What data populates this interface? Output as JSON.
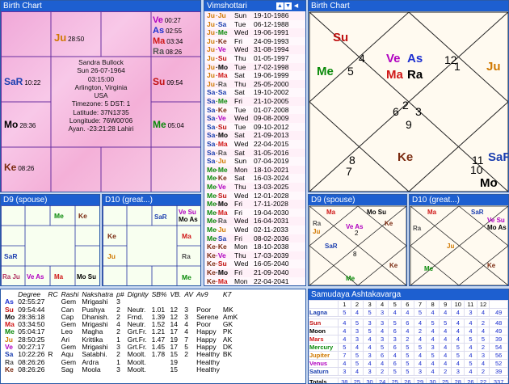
{
  "birth_chart_title": "Birth Chart",
  "vimshottari_title": "Vimshottari",
  "birth_chart2_title": "Birth Chart",
  "d9_title": "D9 (spouse)",
  "d10_title": "D10 (great...)",
  "d9b_title": "D9 (spouse)",
  "d10b_title": "D10 (great...)",
  "samudaya_title": "Samudaya Ashtakavarga",
  "info": {
    "name": "Sandra Bullock",
    "date": "Sun 26-07-1964",
    "time": "03:15:00",
    "place": "Arlington, Virginia",
    "country": "USA",
    "tz": "Timezone: 5 DST: 1",
    "lat": "Latitude: 37N13'35",
    "lon": "Longitude: 76W00'06",
    "ayan": "Ayan. -23:21:28 Lahiri"
  },
  "south_chart": {
    "c1": [
      {
        "p": "Ju",
        "d": "28:50"
      }
    ],
    "c3": [
      {
        "p": "Ve",
        "d": "00:27"
      },
      {
        "p": "As",
        "d": "02:55"
      },
      {
        "p": "Ma",
        "d": "03:34"
      },
      {
        "p": "Ra",
        "d": "08:26"
      }
    ],
    "c12": [
      {
        "p": "SaR",
        "d": "10:22"
      }
    ],
    "c4": [
      {
        "p": "Su",
        "d": "09:54"
      }
    ],
    "c11": [
      {
        "p": "Mo",
        "d": "28:36"
      }
    ],
    "c5": [
      {
        "p": "Me",
        "d": "05:04"
      }
    ],
    "c10": [
      {
        "p": "Ke",
        "d": "08:26"
      }
    ]
  },
  "vimshottari": [
    {
      "a": "Ju",
      "b": "Ju",
      "day": "Sun",
      "date": "19-10-1986"
    },
    {
      "a": "Ju",
      "b": "Sa",
      "day": "Tue",
      "date": "06-12-1988"
    },
    {
      "a": "Ju",
      "b": "Me",
      "day": "Wed",
      "date": "19-06-1991"
    },
    {
      "a": "Ju",
      "b": "Ke",
      "day": "Fri",
      "date": "24-09-1993"
    },
    {
      "a": "Ju",
      "b": "Ve",
      "day": "Wed",
      "date": "31-08-1994"
    },
    {
      "a": "Ju",
      "b": "Su",
      "day": "Thu",
      "date": "01-05-1997"
    },
    {
      "a": "Ju",
      "b": "Mo",
      "day": "Tue",
      "date": "17-02-1998"
    },
    {
      "a": "Ju",
      "b": "Ma",
      "day": "Sat",
      "date": "19-06-1999"
    },
    {
      "a": "Ju",
      "b": "Ra",
      "day": "Thu",
      "date": "25-05-2000"
    },
    {
      "a": "Sa",
      "b": "Sa",
      "day": "Sat",
      "date": "19-10-2002"
    },
    {
      "a": "Sa",
      "b": "Me",
      "day": "Fri",
      "date": "21-10-2005"
    },
    {
      "a": "Sa",
      "b": "Ke",
      "day": "Tue",
      "date": "01-07-2008"
    },
    {
      "a": "Sa",
      "b": "Ve",
      "day": "Wed",
      "date": "09-08-2009"
    },
    {
      "a": "Sa",
      "b": "Su",
      "day": "Tue",
      "date": "09-10-2012"
    },
    {
      "a": "Sa",
      "b": "Mo",
      "day": "Sat",
      "date": "21-09-2013"
    },
    {
      "a": "Sa",
      "b": "Ma",
      "day": "Wed",
      "date": "22-04-2015"
    },
    {
      "a": "Sa",
      "b": "Ra",
      "day": "Sat",
      "date": "31-05-2016"
    },
    {
      "a": "Sa",
      "b": "Ju",
      "day": "Sun",
      "date": "07-04-2019"
    },
    {
      "a": "Me",
      "b": "Me",
      "day": "Mon",
      "date": "18-10-2021"
    },
    {
      "a": "Me",
      "b": "Ke",
      "day": "Sat",
      "date": "16-03-2024"
    },
    {
      "a": "Me",
      "b": "Ve",
      "day": "Thu",
      "date": "13-03-2025"
    },
    {
      "a": "Me",
      "b": "Su",
      "day": "Wed",
      "date": "12-01-2028"
    },
    {
      "a": "Me",
      "b": "Mo",
      "day": "Fri",
      "date": "17-11-2028"
    },
    {
      "a": "Me",
      "b": "Ma",
      "day": "Fri",
      "date": "19-04-2030"
    },
    {
      "a": "Me",
      "b": "Ra",
      "day": "Wed",
      "date": "16-04-2031"
    },
    {
      "a": "Me",
      "b": "Ju",
      "day": "Wed",
      "date": "02-11-2033"
    },
    {
      "a": "Me",
      "b": "Sa",
      "day": "Fri",
      "date": "08-02-2036"
    },
    {
      "a": "Ke",
      "b": "Ke",
      "day": "Mon",
      "date": "18-10-2038"
    },
    {
      "a": "Ke",
      "b": "Ve",
      "day": "Thu",
      "date": "17-03-2039"
    },
    {
      "a": "Ke",
      "b": "Su",
      "day": "Wed",
      "date": "16-05-2040"
    },
    {
      "a": "Ke",
      "b": "Mo",
      "day": "Fri",
      "date": "21-09-2040"
    },
    {
      "a": "Ke",
      "b": "Ma",
      "day": "Mon",
      "date": "22-04-2041"
    }
  ],
  "north_chart": {
    "h1": {
      "num": "2",
      "pl": [
        "Ve",
        "As",
        "Ma",
        "Ra"
      ]
    },
    "h2": {
      "num": "1",
      "pl": [
        "Ju"
      ]
    },
    "h3": {
      "num": "12",
      "pl": []
    },
    "h4": {
      "num": "11",
      "pl": [
        "SaR"
      ]
    },
    "h5": {
      "num": "10",
      "pl": [
        "Mo"
      ]
    },
    "h6": {
      "num": "9",
      "pl": []
    },
    "h7": {
      "num": "8",
      "pl": [
        "Ke"
      ]
    },
    "h8": {
      "num": "7",
      "pl": []
    },
    "h9": {
      "num": "6",
      "pl": []
    },
    "h10": {
      "num": "5",
      "pl": [
        "Me"
      ]
    },
    "h11": {
      "num": "4",
      "pl": [
        "Su"
      ]
    },
    "h12": {
      "num": "3",
      "pl": []
    }
  },
  "d9_south": {
    "r0": [
      "",
      "",
      "Me",
      "Ke"
    ],
    "r3": [
      "Ra Ju",
      "Ve As",
      "Ma",
      "Mo Su"
    ],
    "left2": "SaR"
  },
  "d10_south": {
    "c3": [
      "SaR",
      "Ve Su",
      "Mo As"
    ],
    "left1": "Ke",
    "right1": "Ma",
    "left2": "Ju",
    "right2": "Ra",
    "bot2": "Me"
  },
  "d9_north": {
    "labels": [
      "Ma",
      "Mo Su",
      "Ve As",
      "Ke",
      "Ra",
      "Ju",
      "SaR",
      "Me"
    ],
    "nums": [
      "2",
      "1",
      "12",
      "11",
      "10",
      "9",
      "8",
      "7",
      "6",
      "5",
      "4",
      "3"
    ]
  },
  "d10_north": {
    "labels": [
      "Ma",
      "SaR",
      "Ve Su",
      "Mo As",
      "Ju",
      "Ra",
      "Me",
      "Ke"
    ],
    "nums": [
      "6",
      "5",
      "4",
      "3",
      "2",
      "1",
      "12",
      "11",
      "10",
      "9",
      "8",
      "7"
    ]
  },
  "planet_table": {
    "headers": [
      "",
      "Degree",
      "RC",
      "Rashi",
      "Nakshatra",
      "p#",
      "Dignity",
      "SB%",
      "VB.",
      "AV",
      "Av9",
      "K7"
    ],
    "rows": [
      [
        "As",
        "02:55:27",
        "",
        "Gem",
        "Mrigashi",
        "3",
        "",
        "",
        "",
        "",
        "",
        ""
      ],
      [
        "Su",
        "09:54:44",
        "",
        "Can",
        "Pushya",
        "2",
        "Neutr.",
        "1.01",
        "12",
        "3",
        "Poor",
        "MK"
      ],
      [
        "Mo",
        "28:36:18",
        "",
        "Cap",
        "Dhanish.",
        "2",
        "Frnd.",
        "1.39",
        "12",
        "3",
        "Serene",
        "AmK"
      ],
      [
        "Ma",
        "03:34:50",
        "",
        "Gem",
        "Mrigashi",
        "4",
        "Neutr.",
        "1.52",
        "14",
        "4",
        "Poor",
        "GK"
      ],
      [
        "Me",
        "05:04:17",
        "",
        "Leo",
        "Magha",
        "2",
        "Grt.Fr.",
        "1.21",
        "17",
        "4",
        "Happy",
        "PK"
      ],
      [
        "Ju",
        "28:50:25",
        "",
        "Ari",
        "Krittika",
        "1",
        "Grt.Fr.",
        "1.47",
        "19",
        "7",
        "Happy",
        "AK"
      ],
      [
        "Ve",
        "00:27:17",
        "",
        "Gem",
        "Mrigashi",
        "3",
        "Grt.Fr.",
        "1.45",
        "17",
        "5",
        "Happy",
        "DK"
      ],
      [
        "Sa",
        "10:22:26",
        "R",
        "Aqu",
        "Satabhi.",
        "2",
        "Moolt.",
        "1.78",
        "15",
        "2",
        "Healthy",
        "BK"
      ],
      [
        "Ra",
        "08:26:26",
        "",
        "Gem",
        "Ardra",
        "1",
        "Moolt.",
        "",
        "19",
        "",
        "Healthy",
        ""
      ],
      [
        "Ke",
        "08:26:26",
        "",
        "Sag",
        "Moola",
        "3",
        "Moolt.",
        "",
        "15",
        "",
        "Healthy",
        ""
      ]
    ]
  },
  "samudaya": {
    "header": [
      "",
      "1",
      "2",
      "3",
      "4",
      "5",
      "6",
      "7",
      "8",
      "9",
      "10",
      "11",
      "12",
      ""
    ],
    "rows": [
      {
        "name": "Lagna",
        "vals": [
          "5",
          "4",
          "5",
          "3",
          "4",
          "4",
          "5",
          "4",
          "4",
          "4",
          "3",
          "4"
        ],
        "tot": "49"
      },
      {
        "name": "Sun",
        "vals": [
          "4",
          "5",
          "3",
          "3",
          "5",
          "6",
          "4",
          "5",
          "5",
          "4",
          "4",
          "2"
        ],
        "tot": "48"
      },
      {
        "name": "Moon",
        "vals": [
          "4",
          "3",
          "5",
          "4",
          "6",
          "4",
          "2",
          "4",
          "4",
          "4",
          "4",
          "4"
        ],
        "tot": "49"
      },
      {
        "name": "Mars",
        "vals": [
          "4",
          "3",
          "4",
          "3",
          "3",
          "2",
          "4",
          "4",
          "4",
          "4",
          "5",
          "5"
        ],
        "tot": "39"
      },
      {
        "name": "Mercury",
        "vals": [
          "5",
          "4",
          "4",
          "5",
          "6",
          "5",
          "5",
          "3",
          "4",
          "5",
          "4",
          "2"
        ],
        "tot": "54"
      },
      {
        "name": "Jupiter",
        "vals": [
          "7",
          "5",
          "3",
          "6",
          "4",
          "5",
          "4",
          "5",
          "4",
          "5",
          "4",
          "3"
        ],
        "tot": "56"
      },
      {
        "name": "Venus",
        "vals": [
          "4",
          "5",
          "4",
          "4",
          "6",
          "5",
          "4",
          "4",
          "4",
          "4",
          "5",
          "4"
        ],
        "tot": "52"
      },
      {
        "name": "Saturn",
        "vals": [
          "3",
          "4",
          "3",
          "2",
          "5",
          "5",
          "3",
          "4",
          "2",
          "3",
          "4",
          "2"
        ],
        "tot": "39"
      }
    ],
    "totals": {
      "name": "Totals",
      "vals": [
        "38",
        "25",
        "30",
        "24",
        "25",
        "26",
        "29",
        "30",
        "25",
        "28",
        "26",
        "22"
      ],
      "tot": "337"
    }
  },
  "colors": {
    "title_bar": "#1d5fd0",
    "border": "#2a5aa8"
  }
}
